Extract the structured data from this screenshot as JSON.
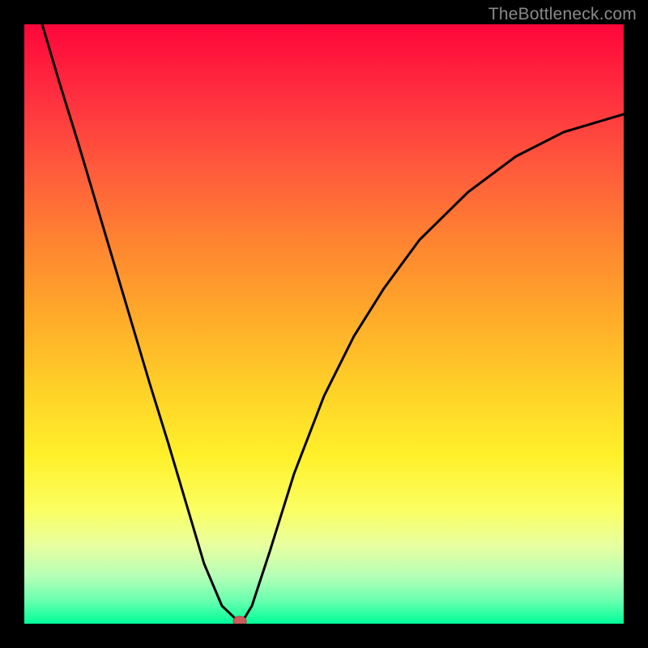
{
  "watermark": {
    "text": "TheBottleneck.com"
  },
  "chart_data": {
    "type": "line",
    "title": "",
    "xlabel": "",
    "ylabel": "",
    "xlim": [
      0,
      100
    ],
    "ylim": [
      0,
      100
    ],
    "grid": false,
    "series": [
      {
        "name": "bottleneck-curve",
        "x": [
          3,
          6,
          9,
          12,
          15,
          18,
          21,
          24,
          27,
          30,
          33,
          35.5,
          36.5,
          38,
          41,
          45,
          50,
          55,
          60,
          66,
          74,
          82,
          90,
          100
        ],
        "values": [
          100,
          90,
          80,
          70,
          60,
          50,
          40,
          30,
          20,
          10,
          3,
          0.5,
          0.5,
          3,
          12,
          25,
          38,
          48,
          56,
          64,
          72,
          78,
          82,
          85
        ]
      }
    ],
    "markers": [
      {
        "name": "optimal-point",
        "x": 36,
        "y": 0,
        "color": "#d35a5a",
        "rx": 8,
        "ry": 6
      }
    ],
    "background": {
      "type": "vertical-gradient",
      "stops": [
        {
          "pos": 0,
          "color": "#ff063a"
        },
        {
          "pos": 50,
          "color": "#ffa82a"
        },
        {
          "pos": 80,
          "color": "#fbff62"
        },
        {
          "pos": 100,
          "color": "#00ff99"
        }
      ]
    }
  }
}
